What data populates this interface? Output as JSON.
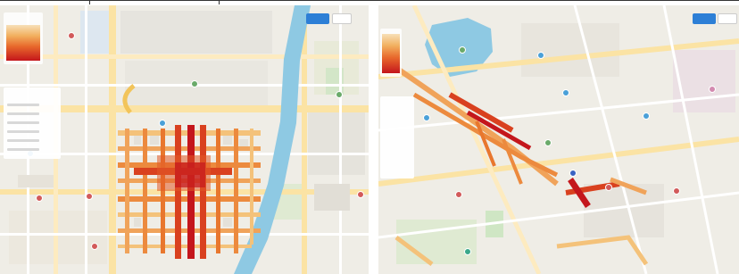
{
  "left_map": {
    "legend_title": "",
    "layer_panel_title": "",
    "button_label": "",
    "heat_color_low": "#f4c27a",
    "heat_color_mid": "#e8772e",
    "heat_color_high": "#c4161c",
    "river_color": "#8ec9e3",
    "park_color": "#cfe6c4"
  },
  "right_map": {
    "legend_title": "",
    "layer_panel_title": "",
    "button_label": "",
    "lake_color": "#8ec9e3",
    "heat_color_high": "#c4161c"
  },
  "colors": {
    "road_major": "#fbe2a0",
    "road_minor": "#ffffff",
    "block": "#ece9e1",
    "accent_button": "#2d7fd6"
  }
}
